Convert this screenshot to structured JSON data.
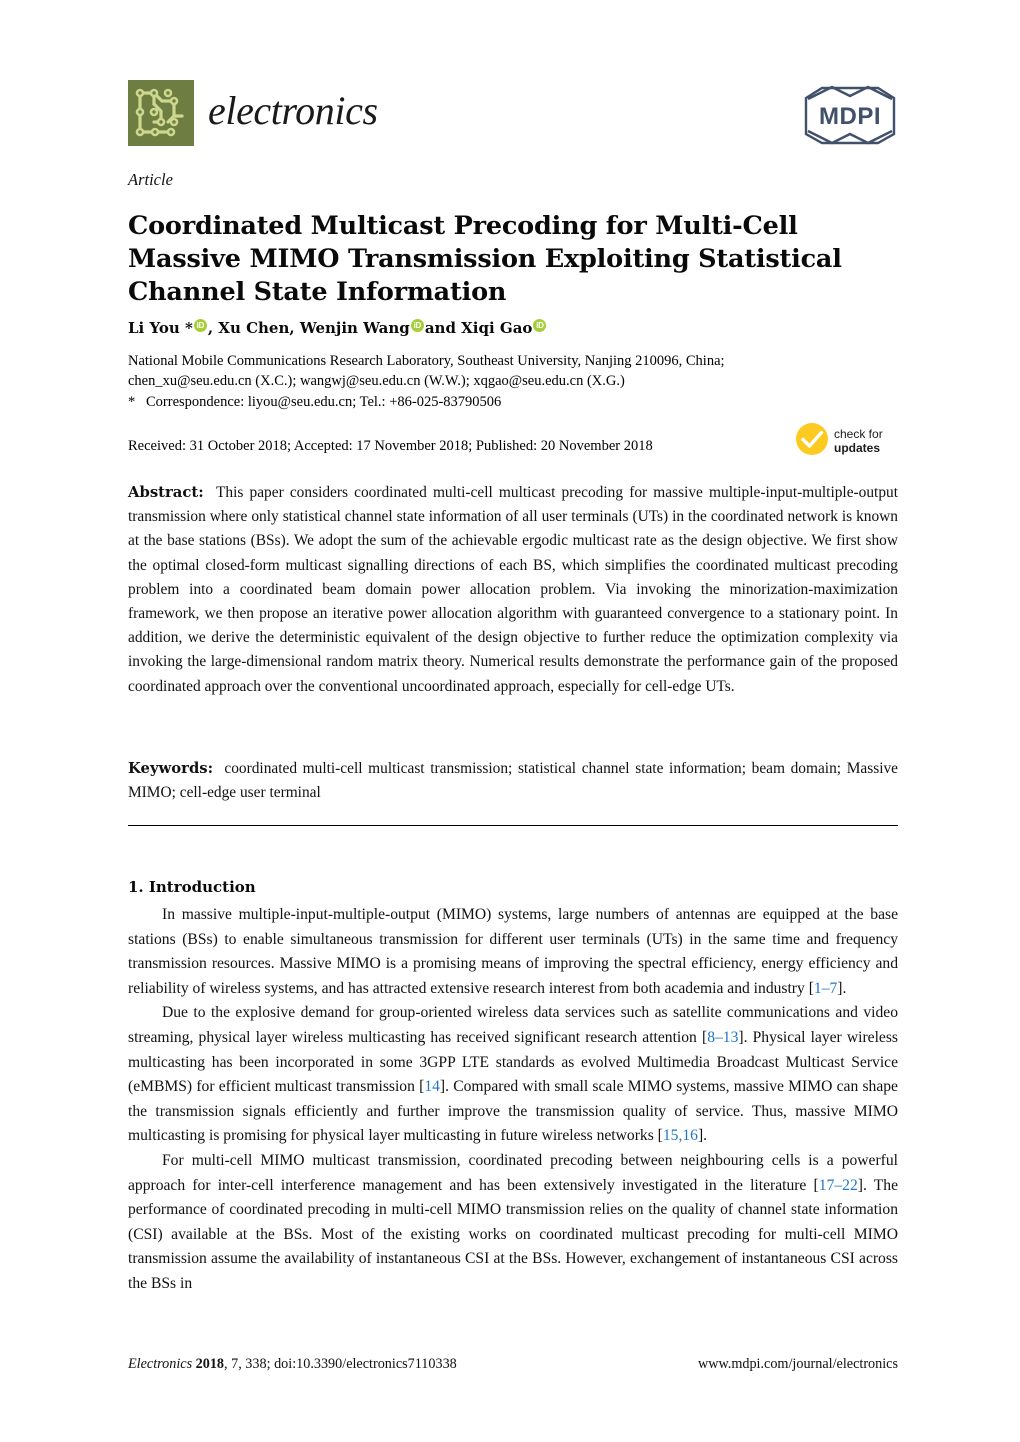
{
  "journal": {
    "name": "electronics",
    "logo_icon": "circuit-board-icon",
    "logo_color": "#6e7d41",
    "publisher_logo_icon": "mdpi-hexagon-logo",
    "publisher_name": "MDPI",
    "publisher_color": "#41506b"
  },
  "article": {
    "type_label": "Article",
    "title": "Coordinated Multicast Precoding for Multi-Cell Massive MIMO Transmission Exploiting Statistical Channel State Information",
    "authors_text": "Li You *, Xu Chen, Wenjin Wang and Xiqi Gao",
    "authors": [
      {
        "name": "Li You *",
        "orcid": true
      },
      {
        "name": ", Xu Chen",
        "orcid": false
      },
      {
        "name": ", Wenjin Wang",
        "orcid": true
      },
      {
        "name": " and Xiqi Gao",
        "orcid": true
      }
    ],
    "orcid_label": "iD",
    "orcid_color": "#a6ce39",
    "affiliation": "National Mobile Communications Research Laboratory, Southeast University, Nanjing 210096, China;",
    "emails": "chen_xu@seu.edu.cn (X.C.); wangwj@seu.edu.cn (W.W.); xqgao@seu.edu.cn (X.G.)",
    "correspondence_marker": "*",
    "correspondence": "Correspondence: liyou@seu.edu.cn; Tel.: +86-025-83790506",
    "dates": "Received: 31 October 2018; Accepted: 17 November 2018; Published: 20 November 2018"
  },
  "crossmark": {
    "line1": "check for",
    "line2": "updates",
    "icon": "yellow-check-circle-icon",
    "color": "#fdca21"
  },
  "abstract": {
    "label": "Abstract:",
    "text": "This paper considers coordinated multi-cell multicast precoding for massive multiple-input-multiple-output transmission where only statistical channel state information of all user terminals (UTs) in the coordinated network is known at the base stations (BSs). We adopt the sum of the achievable ergodic multicast rate as the design objective. We first show the optimal closed-form multicast signalling directions of each BS, which simplifies the coordinated multicast precoding problem into a coordinated beam domain power allocation problem. Via invoking the minorization-maximization framework, we then propose an iterative power allocation algorithm with guaranteed convergence to a stationary point. In addition, we derive the deterministic equivalent of the design objective to further reduce the optimization complexity via invoking the large-dimensional random matrix theory. Numerical results demonstrate the performance gain of the proposed coordinated approach over the conventional uncoordinated approach, especially for cell-edge UTs."
  },
  "keywords": {
    "label": "Keywords:",
    "text": "coordinated multi-cell multicast transmission; statistical channel state information; beam domain; Massive MIMO; cell-edge user terminal"
  },
  "section": {
    "heading": "1. Introduction",
    "paragraph1_a": "In massive multiple-input-multiple-output (MIMO) systems, large numbers of antennas are equipped at the base stations (BSs) to enable simultaneous transmission for different user terminals (UTs) in the same time and frequency transmission resources. Massive MIMO is a promising means of improving the spectral efficiency, energy efficiency and reliability of wireless systems, and has attracted extensive research interest from both academia and industry [",
    "paragraph1_cite": "1–7",
    "paragraph1_b": "].",
    "paragraph2_a": "Due to the explosive demand for group-oriented wireless data services such as satellite communications and video streaming, physical layer wireless multicasting has received significant research attention [",
    "paragraph2_cite1": "8–13",
    "paragraph2_b": "]. Physical layer wireless multicasting has been incorporated in some 3GPP LTE standards as evolved Multimedia Broadcast Multicast Service (eMBMS) for efficient multicast transmission [",
    "paragraph2_cite2": "14",
    "paragraph2_c": "].  Compared with small scale MIMO systems, massive MIMO can shape the transmission signals efficiently and further improve the transmission quality of service. Thus, massive MIMO multicasting is promising for physical layer multicasting in future wireless networks [",
    "paragraph2_cite3": "15,16",
    "paragraph2_d": "].",
    "paragraph3_a": "For multi-cell MIMO multicast transmission, coordinated precoding between neighbouring cells is a powerful approach for inter-cell interference management and has been extensively investigated in the literature [",
    "paragraph3_cite": "17–22",
    "paragraph3_b": "]. The performance of coordinated precoding in multi-cell MIMO transmission relies on the quality of channel state information (CSI) available at the BSs.  Most of the existing works on coordinated multicast precoding for multi-cell MIMO transmission assume the availability of instantaneous CSI at the BSs.  However, exchangement of instantaneous CSI across the BSs in"
  },
  "footer": {
    "left_journal": "Electronics",
    "left_year": "2018",
    "left_rest": ", 7, 338; doi:10.3390/electronics7110338",
    "right": "www.mdpi.com/journal/electronics"
  }
}
